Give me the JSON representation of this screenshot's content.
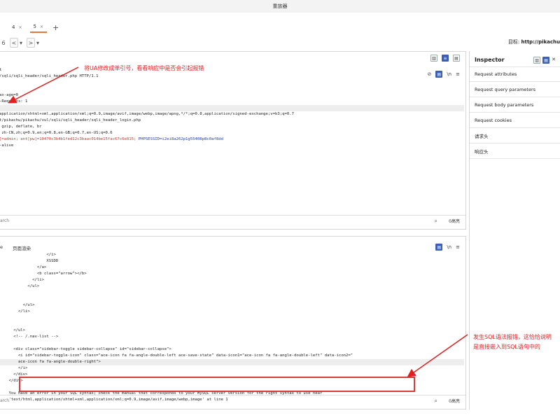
{
  "window_title": "重放器",
  "tabs": [
    {
      "label": "4",
      "close": "×"
    },
    {
      "label": "5",
      "close": "×"
    }
  ],
  "tab_add": "+",
  "nav": {
    "left_label": "6",
    "back": "<",
    "back_dd": "▾",
    "fwd": ">",
    "fwd_dd": "▾",
    "target_label": "目标:",
    "target_value": "http://pikachu"
  },
  "request": {
    "lines": [
      "",
      "",
      "t",
      "/sqli/sqli_header/sqli_header.php HTTP/1.1",
      "",
      "",
      "ax-age=0",
      "-Requests: 1",
      "",
      "application/xhtml+xml,application/xml;q=0.9,image/avif,image/webp,image/apng,*/*;q=0.8,application/signed-exchange;v=b3;q=0.7",
      "t/pikachu/pikachu/vul/sqli/sqli_header/sqli_header_login.php",
      " gzip, deflate, br",
      " zh-CN,zh;q=0.9,en;q=0.8,en-GB;q=0.7,en-US;q=0.6",
      "]=admin; ant[pw]=10470c3b4b1fed12c3baac014be15fac67c6e815; PHPSESSID=i2ei8a262p1g55408p8c0af8dd",
      "-alive",
      ""
    ],
    "highlight_line": 8,
    "cookie_line": 13,
    "search_placeholder": "arch",
    "search_count": "0高亮"
  },
  "response": {
    "tab_label": "页面渲染",
    "tab_prefix": "e",
    "lines": [
      "                    </i>",
      "                    XSSDD",
      "                </a>",
      "                <b class=\"arrow\"></b>",
      "              </li>",
      "            </ul>",
      "",
      "",
      "          </ul>",
      "        </li>",
      "",
      "",
      "      </ul>",
      "      <!-- /.nav-list -->",
      "",
      "      <div class=\"sidebar-toggle sidebar-collapse\" id=\"sidebar-collapse\">",
      "        <i id=\"sidebar-toggle-icon\" class=\"ace-icon fa fa-angle-double-left ace-save-state\" data-icon1=\"ace-icon fa fa-angle-double-left\" data-icon2=\"",
      "        ace-icon fa fa-angle-double-right\">",
      "        </i>",
      "      </div>",
      "    </div>",
      "",
      "    You have an error in your SQL syntax; check the manual that corresponds to your MySQL server version for the right syntax to use near",
      "    'text/html,application/xhtml+xml,application/xml;q=0.9,image/avif,image/webp,image' at line 1"
    ],
    "highlight_line": 17,
    "search_placeholder": "arch",
    "search_count": "0高亮"
  },
  "inspector": {
    "title": "Inspector",
    "items": [
      "Request attributes",
      "Request query parameters",
      "Request body parameters",
      "Request cookies",
      "请求头",
      "响应头"
    ]
  },
  "annotations": {
    "top": "将UA修改成单引号，看看响应中是否会引起报错",
    "bottom_line1": "发生SQL语法报错，这恰恰说明",
    "bottom_line2": "是直接嵌入到SQL语句中的"
  },
  "colors": {
    "annotation": "#e02020",
    "accent": "#e8743b",
    "toggle_on": "#3b5fb3"
  }
}
